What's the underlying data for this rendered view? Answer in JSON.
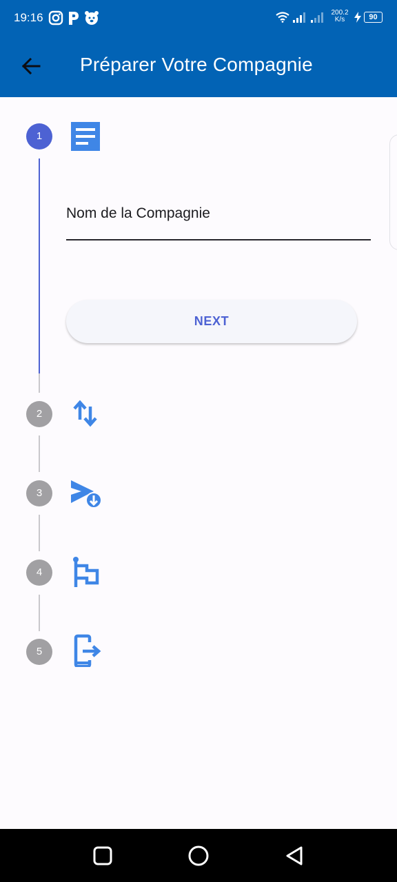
{
  "status_bar": {
    "time": "19:16",
    "left_icons": [
      "instagram-icon",
      "p-app-icon",
      "bear-app-icon"
    ],
    "net_speed_value": "200.2",
    "net_speed_unit": "K/s",
    "battery": "90"
  },
  "app_bar": {
    "title": "Préparer Votre Compagnie",
    "back_icon": "arrow-back-icon",
    "color": "#0263b5"
  },
  "stepper": {
    "active_color": "#4d62d3",
    "inactive_color": "#a1a0a3",
    "steps": [
      {
        "number": "1",
        "icon": "article-icon",
        "state": "active"
      },
      {
        "number": "2",
        "icon": "swap-vert-icon",
        "state": "inactive"
      },
      {
        "number": "3",
        "icon": "send-download-icon",
        "state": "inactive"
      },
      {
        "number": "4",
        "icon": "flag-icon",
        "state": "inactive"
      },
      {
        "number": "5",
        "icon": "phone-exit-icon",
        "state": "inactive"
      }
    ]
  },
  "form": {
    "company_name_placeholder": "Nom de la Compagnie",
    "company_name_value": "",
    "next_label": "NEXT"
  },
  "nav_bar": {
    "buttons": [
      "recents-square-icon",
      "home-circle-icon",
      "back-triangle-icon"
    ]
  }
}
